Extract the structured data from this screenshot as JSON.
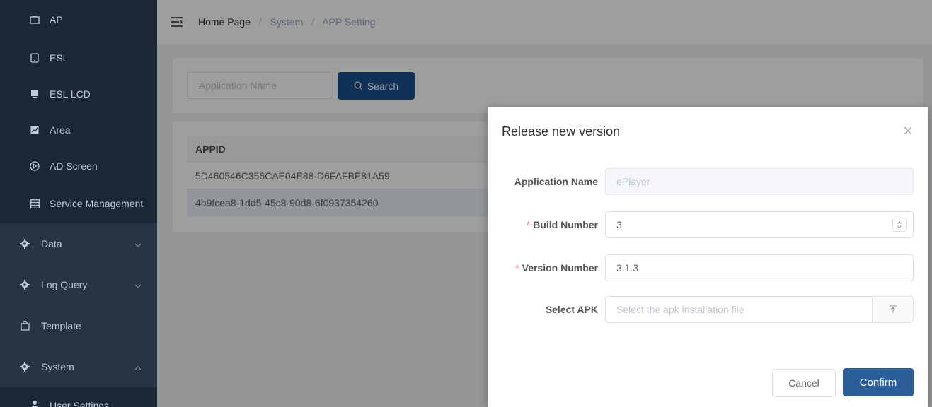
{
  "sidebar": {
    "top_items": [
      {
        "label": "AP",
        "icon": "monitor-icon"
      },
      {
        "label": "ESL",
        "icon": "tablet-icon"
      },
      {
        "label": "ESL LCD",
        "icon": "display-icon"
      },
      {
        "label": "Area",
        "icon": "chart-icon"
      },
      {
        "label": "AD Screen",
        "icon": "play-circle-icon"
      },
      {
        "label": "Service Management",
        "icon": "grid-icon"
      }
    ],
    "menus": [
      {
        "label": "Data",
        "icon": "gear-icon",
        "expanded": false
      },
      {
        "label": "Log Query",
        "icon": "gear-icon",
        "expanded": false
      },
      {
        "label": "Template",
        "icon": "bag-icon"
      },
      {
        "label": "System",
        "icon": "gear-icon",
        "expanded": true
      }
    ],
    "bottom_items": [
      {
        "label": "User Settings",
        "icon": "user-icon"
      }
    ]
  },
  "breadcrumb": {
    "home": "Home Page",
    "section": "System",
    "page": "APP Setting",
    "separator": "/"
  },
  "search": {
    "placeholder": "Application Name",
    "button_label": "Search"
  },
  "table": {
    "column": "APPID",
    "rows": [
      "5D460546C356CAE04E88-D6FAFBE81A59",
      "4b9fcea8-1dd5-45c8-90d8-6f0937354260"
    ]
  },
  "dialog": {
    "title": "Release new version",
    "required_mark": "*",
    "fields": {
      "app_name": {
        "label": "Application Name",
        "placeholder": "ePlayer"
      },
      "build_number": {
        "label": "Build Number",
        "value": "3"
      },
      "version_number": {
        "label": "Version Number",
        "value": "3.1.3"
      },
      "select_apk": {
        "label": "Select APK",
        "placeholder": "Select the apk installation file"
      }
    },
    "cancel_label": "Cancel",
    "confirm_label": "Confirm"
  },
  "colors": {
    "sidebar_bg": "#1f2d3d",
    "primary": "#1b4f8a",
    "confirm": "#2c5f9a",
    "required": "#f56c6c"
  }
}
